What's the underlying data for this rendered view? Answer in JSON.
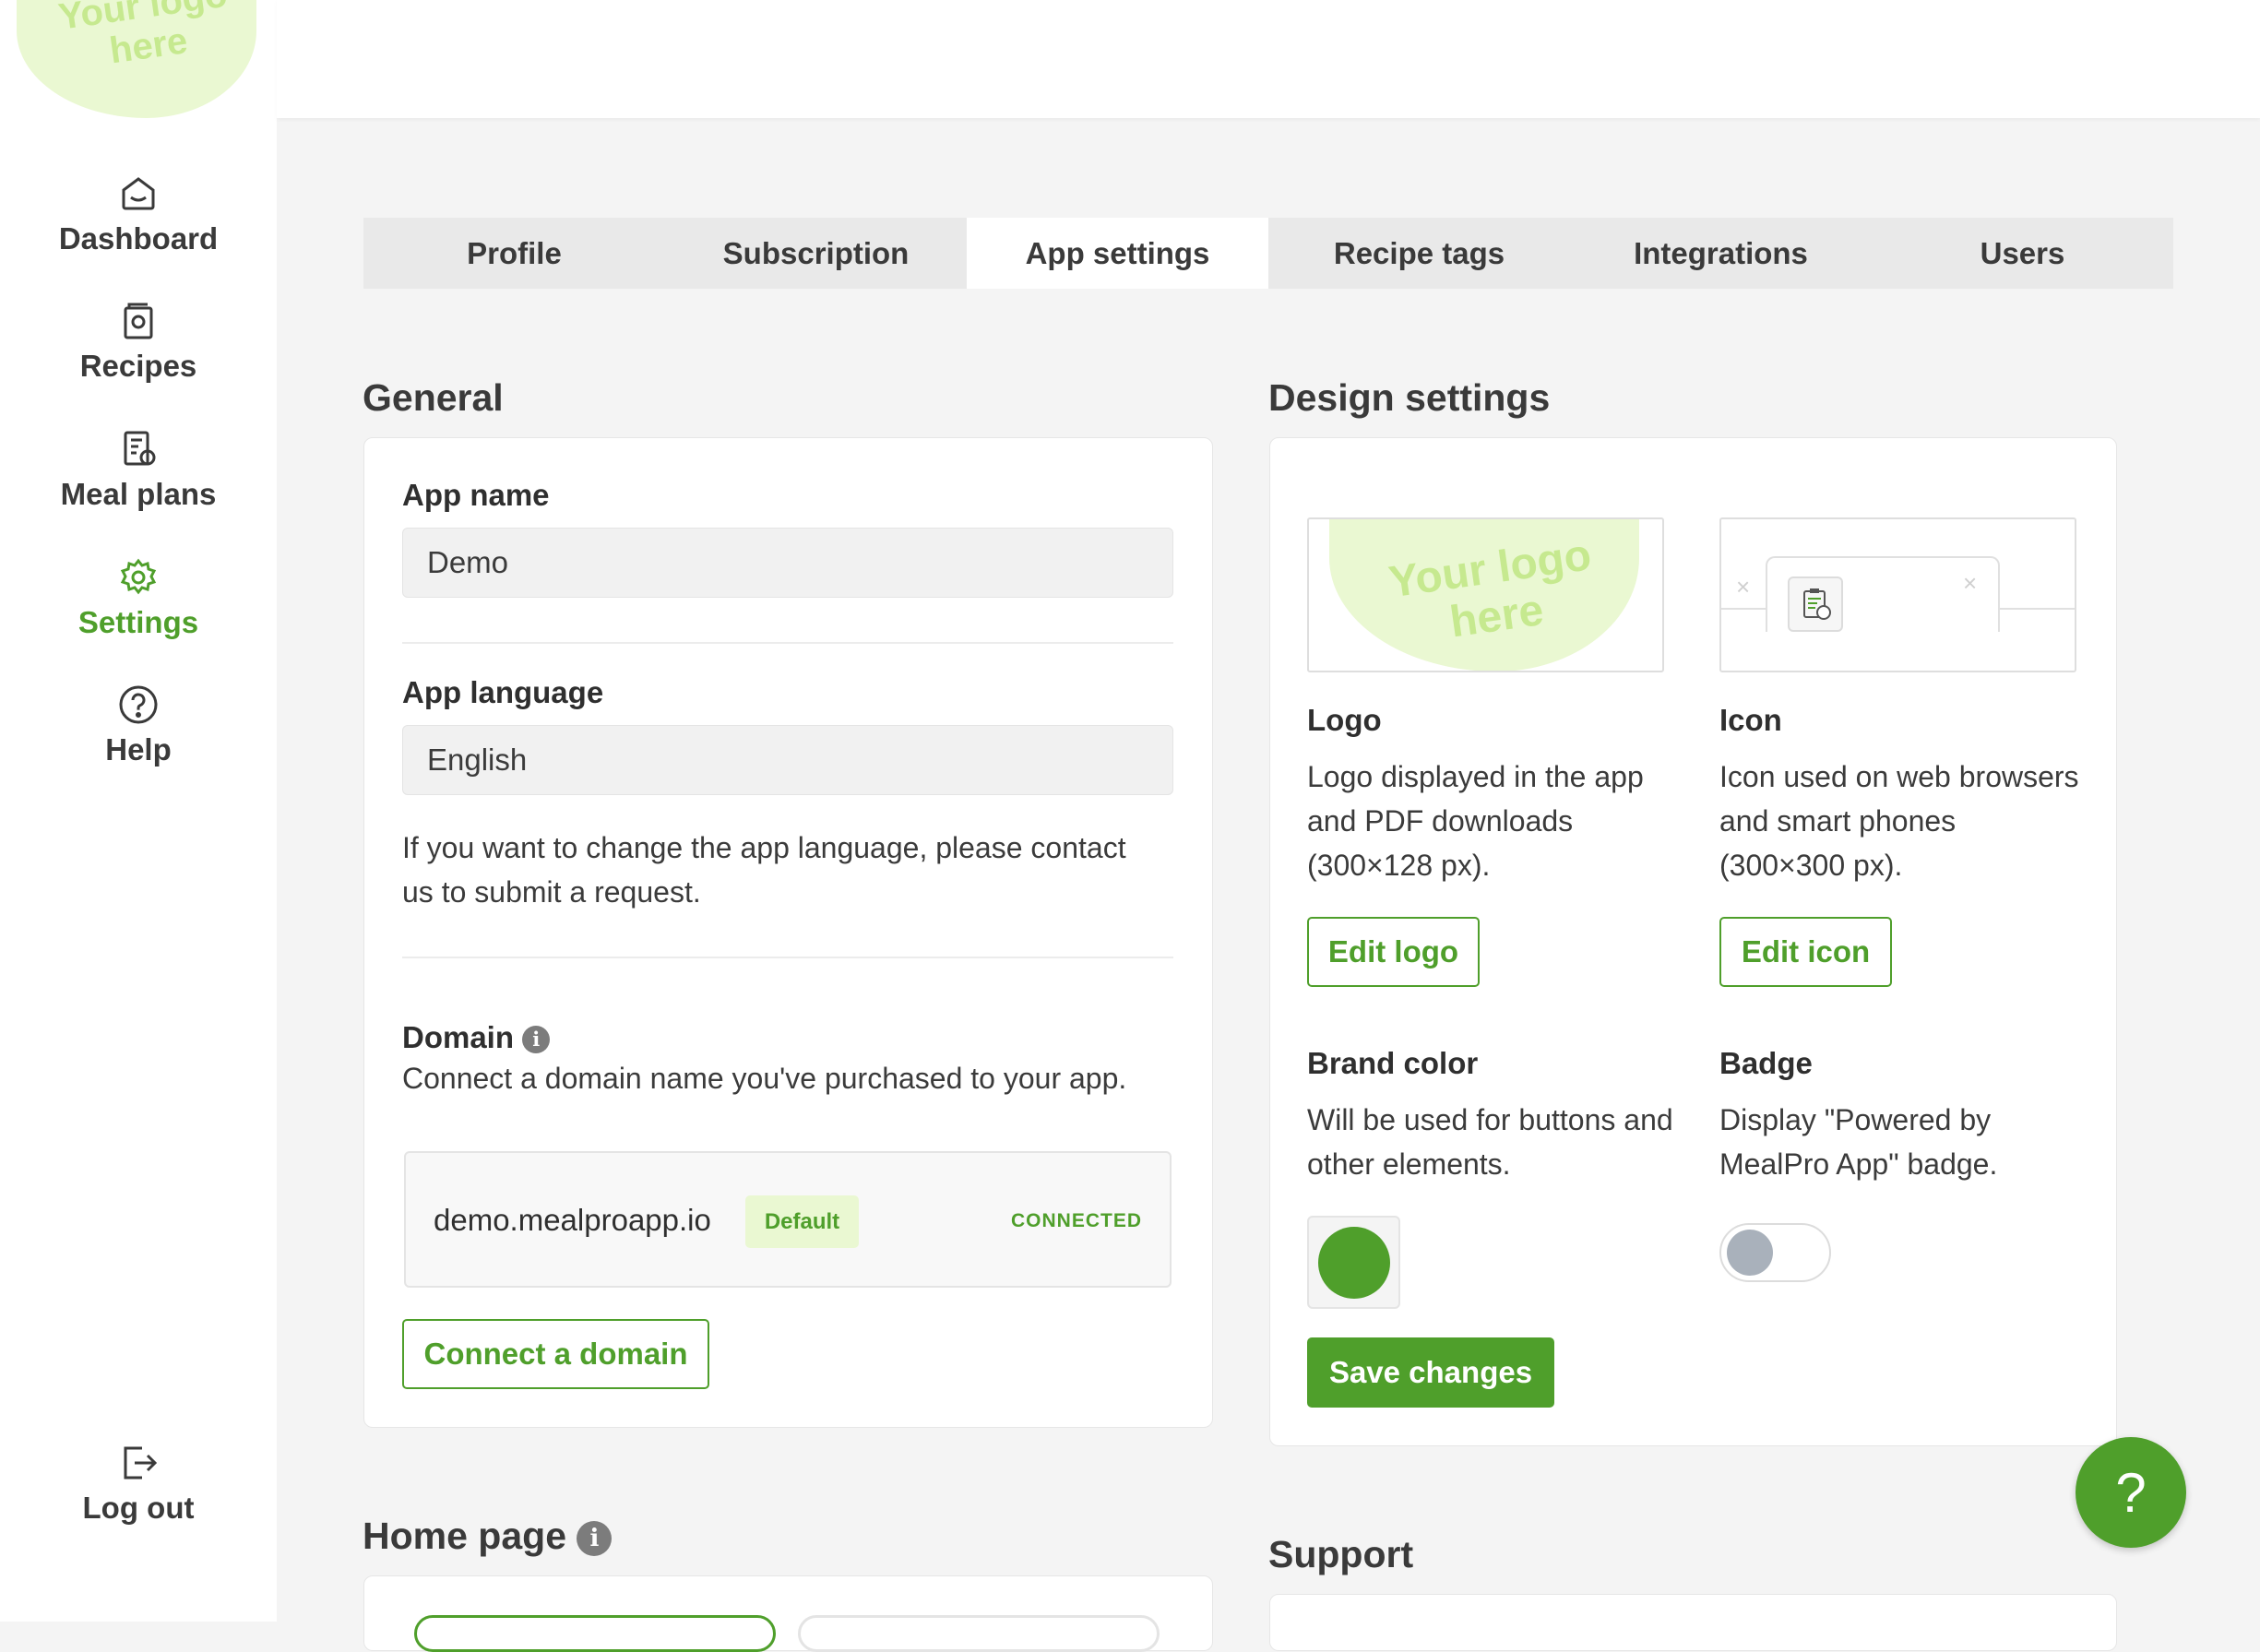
{
  "sidebar": {
    "logo_text": "Your logo here",
    "items": [
      {
        "label": "Dashboard",
        "icon": "home-icon"
      },
      {
        "label": "Recipes",
        "icon": "recipe-book-icon"
      },
      {
        "label": "Meal plans",
        "icon": "meal-plan-icon"
      },
      {
        "label": "Settings",
        "icon": "gear-icon",
        "active": true
      },
      {
        "label": "Help",
        "icon": "question-circle-icon"
      }
    ],
    "logout_label": "Log out"
  },
  "tabs": [
    {
      "label": "Profile"
    },
    {
      "label": "Subscription"
    },
    {
      "label": "App settings",
      "active": true
    },
    {
      "label": "Recipe tags"
    },
    {
      "label": "Integrations"
    },
    {
      "label": "Users"
    }
  ],
  "general": {
    "title": "General",
    "app_name_label": "App name",
    "app_name_value": "Demo",
    "app_language_label": "App language",
    "app_language_value": "English",
    "language_note": "If you want to change the app language, please contact us to submit a request.",
    "domain_label": "Domain",
    "domain_description": "Connect a domain name you've purchased to your app.",
    "domain_name": "demo.mealproapp.io",
    "domain_badge": "Default",
    "domain_status": "CONNECTED",
    "connect_button": "Connect a domain"
  },
  "design": {
    "title": "Design settings",
    "logo_preview_text": "Your logo here",
    "logo_label": "Logo",
    "logo_description": "Logo displayed in the app and PDF downloads (300×128 px).",
    "edit_logo_button": "Edit logo",
    "icon_label": "Icon",
    "icon_description": "Icon used on web browsers and smart phones (300×300 px).",
    "edit_icon_button": "Edit icon",
    "brand_color_label": "Brand color",
    "brand_color_description": "Will be used for buttons and other elements.",
    "brand_color": "#4f9f2b",
    "badge_label": "Badge",
    "badge_description": "Display \"Powered by MealPro App\" badge.",
    "badge_enabled": false,
    "save_button": "Save changes"
  },
  "home_page": {
    "title": "Home page"
  },
  "support": {
    "title": "Support"
  },
  "help_fab": {
    "symbol": "?"
  }
}
